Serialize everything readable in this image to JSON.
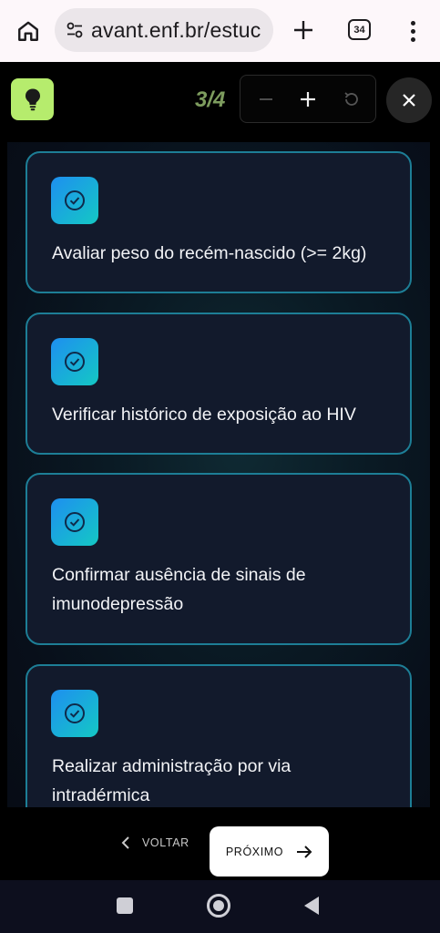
{
  "browser": {
    "url": "avant.enf.br/estuc",
    "tab_count": "34"
  },
  "header": {
    "progress": "3/4",
    "accent_color": "#b6ec6d"
  },
  "cards": [
    {
      "text": "Avaliar peso do recém-nascido (>= 2kg)",
      "icon": "check-circle-icon"
    },
    {
      "text": "Verificar histórico de exposição ao HIV",
      "icon": "check-circle-icon"
    },
    {
      "text": "Confirmar ausência de sinais de imunodepressão",
      "icon": "check-circle-icon"
    },
    {
      "text": "Realizar administração por via intradérmica",
      "icon": "check-circle-icon"
    }
  ],
  "nav": {
    "back_label": "VOLTAR",
    "next_label": "PRÓXIMO"
  }
}
